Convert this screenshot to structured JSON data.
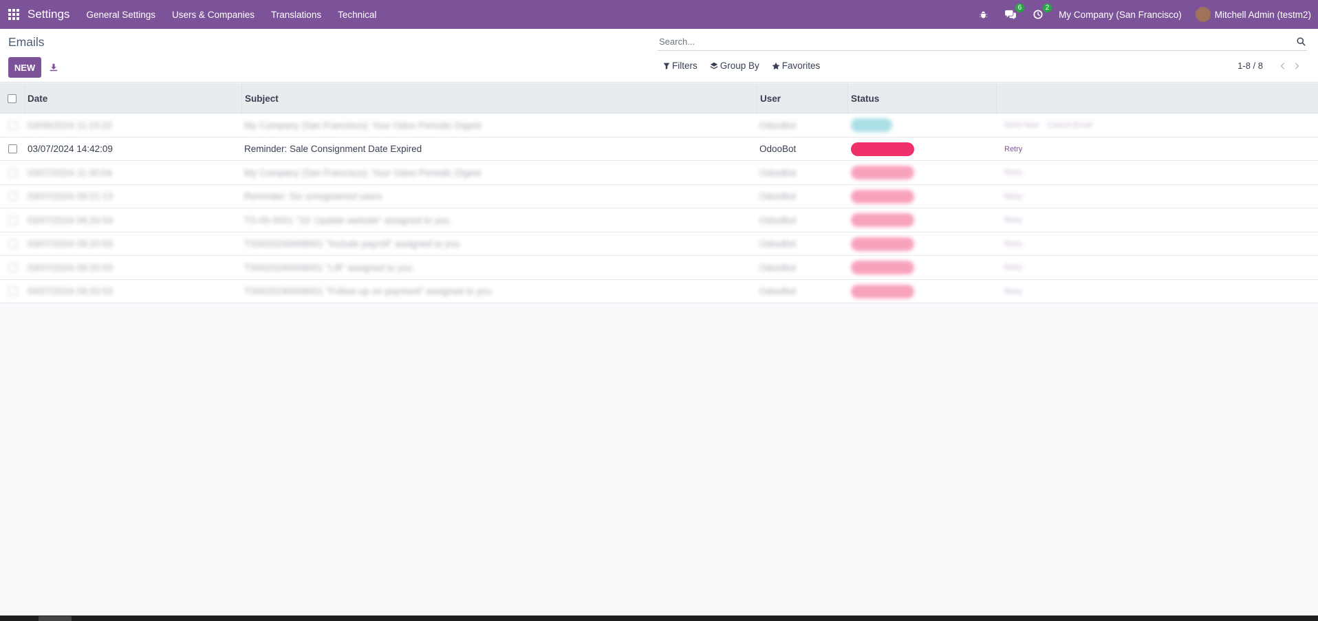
{
  "navbar": {
    "app_title": "Settings",
    "menu": [
      "General Settings",
      "Users & Companies",
      "Translations",
      "Technical"
    ],
    "messages_count": "6",
    "activities_count": "2",
    "company": "My Company (San Francisco)",
    "user": "Mitchell Admin (testm2)",
    "color": "#7c5298"
  },
  "control_panel": {
    "breadcrumb": "Emails",
    "new_label": "NEW",
    "search_placeholder": "Search...",
    "filters_label": "Filters",
    "groupby_label": "Group By",
    "favorites_label": "Favorites",
    "pager_value": "1-8 / 8"
  },
  "table": {
    "columns": [
      "Date",
      "Subject",
      "User",
      "Status"
    ],
    "rows": [
      {
        "date": "03/08/2024 11:23:22",
        "subject": "My Company (San Francisco): Your Odoo Periodic Digest",
        "user": "OdooBot",
        "status_color": "#44b9c9",
        "blurred": true,
        "actions": [
          "Send Now",
          "Cancel Email"
        ]
      },
      {
        "date": "03/07/2024 14:42:09",
        "subject": "Reminder: Sale Consignment Date Expired",
        "user": "OdooBot",
        "status_color": "#f0306a",
        "blurred": false,
        "actions": [
          "Retry"
        ]
      },
      {
        "date": "03/07/2024 11:30:04",
        "subject": "My Company (San Francisco): Your Odoo Periodic Digest",
        "user": "OdooBot",
        "status_color": "#f0306a",
        "blurred": true,
        "actions": [
          "Retry"
        ]
      },
      {
        "date": "03/07/2024 09:21:13",
        "subject": "Reminder: Six unregistered users",
        "user": "OdooBot",
        "status_color": "#f0306a",
        "blurred": true,
        "actions": [
          "Retry"
        ]
      },
      {
        "date": "03/07/2024 09:20:54",
        "subject": "TS-05-0001 \"10: Update website\" assigned to you",
        "user": "OdooBot",
        "status_color": "#f0306a",
        "blurred": true,
        "actions": [
          "Retry"
        ]
      },
      {
        "date": "03/07/2024 09:20:53",
        "subject": "TS0020240008001 \"Include payroll\" assigned to you",
        "user": "OdooBot",
        "status_color": "#f0306a",
        "blurred": true,
        "actions": [
          "Retry"
        ]
      },
      {
        "date": "03/07/2024 09:20:53",
        "subject": "TS0020240008001 \"Lift\" assigned to you",
        "user": "OdooBot",
        "status_color": "#f0306a",
        "blurred": true,
        "actions": [
          "Retry"
        ]
      },
      {
        "date": "03/07/2024 09:20:53",
        "subject": "TS0020240008001 \"Follow-up on payment\" assigned to you",
        "user": "OdooBot",
        "status_color": "#f0306a",
        "blurred": true,
        "actions": [
          "Retry"
        ]
      }
    ]
  }
}
